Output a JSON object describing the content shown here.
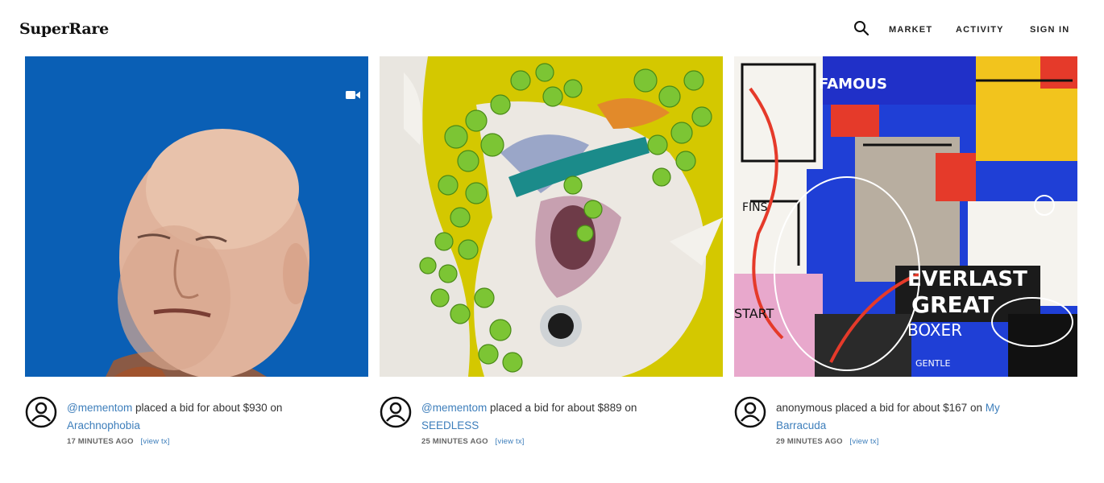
{
  "header": {
    "logo": "SuperRare",
    "nav": {
      "market": "MARKET",
      "activity": "ACTIVITY",
      "sign_in": "SIGN IN"
    }
  },
  "cards": [
    {
      "user": "@mementom",
      "action": "placed a bid for about $930 on",
      "artwork": "Arachnophobia",
      "time": "17 MINUTES AGO",
      "tx": "[view tx]",
      "media_icon": "video-camera-icon"
    },
    {
      "user": "@mementom",
      "action": "placed a bid for about $889 on",
      "artwork": "SEEDLESS",
      "time": "25 MINUTES AGO",
      "tx": "[view tx]"
    },
    {
      "user": "anonymous",
      "action": "placed a bid for about $167 on",
      "artwork": "My Barracuda",
      "time": "29 MINUTES AGO",
      "tx": "[view tx]"
    }
  ],
  "colors": {
    "link": "#3d7ebb",
    "card1_bg": "#0a5fb5",
    "card2_bg": "#d4c800"
  }
}
